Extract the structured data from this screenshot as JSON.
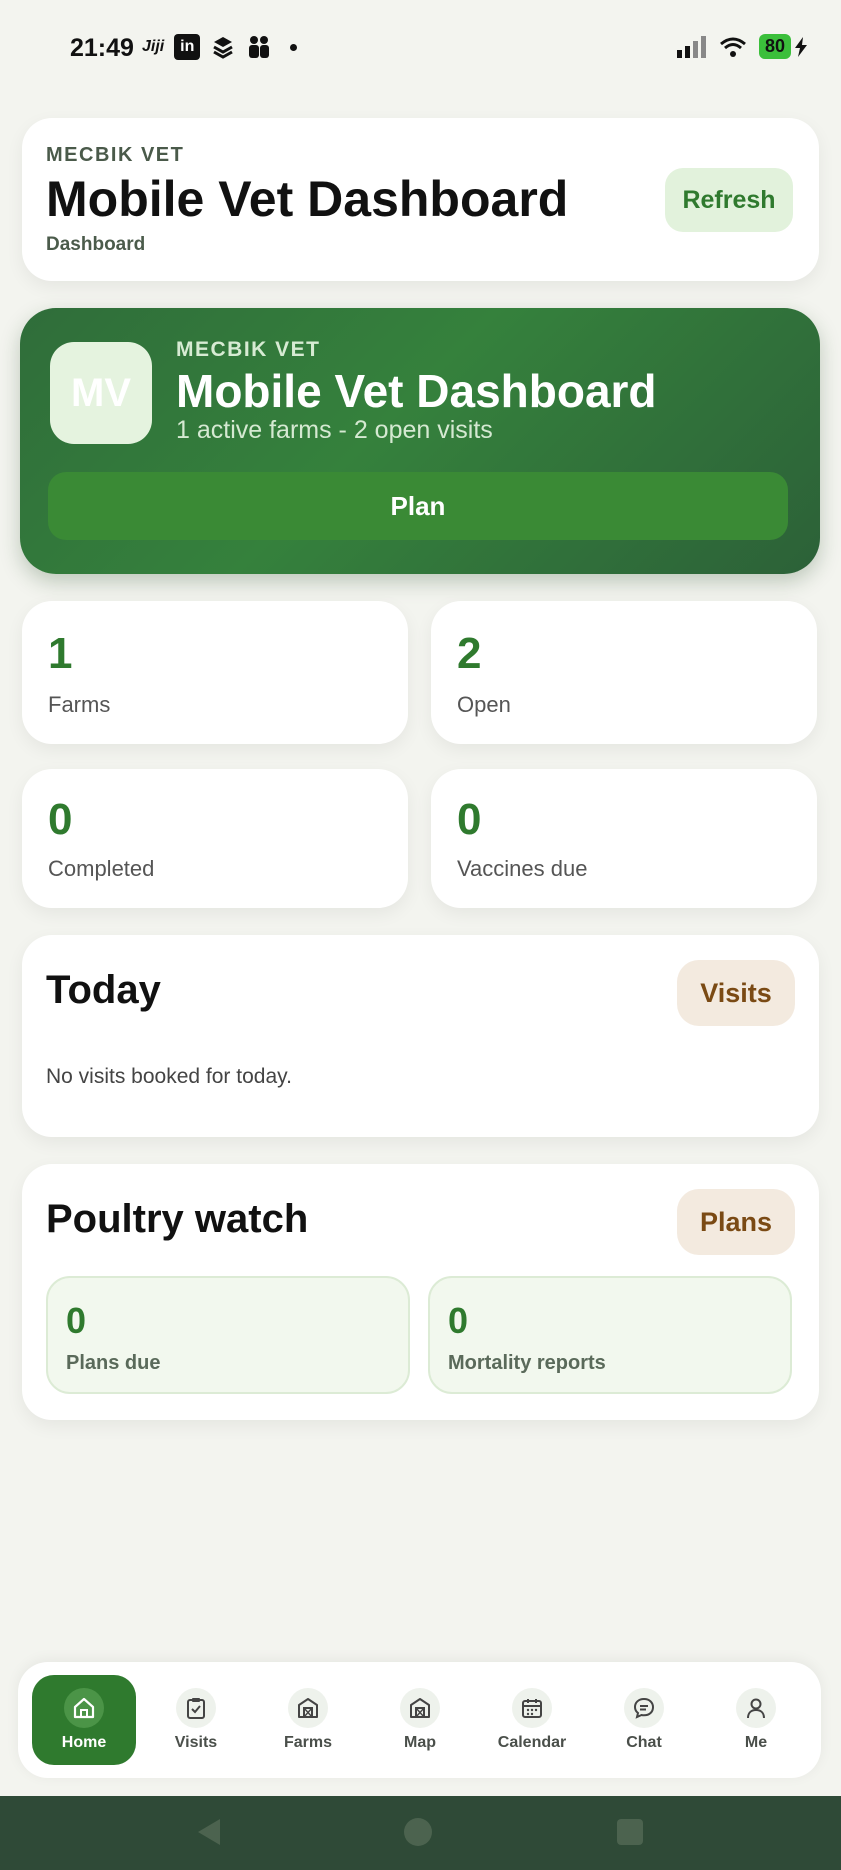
{
  "status_bar": {
    "time": "21:49",
    "app_label": "Jiji",
    "linkedin_label": "in",
    "battery": "80"
  },
  "header": {
    "eyebrow": "MECBIK VET",
    "title": "Mobile Vet Dashboard",
    "subtitle": "Dashboard",
    "refresh_label": "Refresh"
  },
  "hero": {
    "avatar_initials": "MV",
    "eyebrow": "MECBIK VET",
    "title": "Mobile Vet Dashboard",
    "subtitle": "1 active farms - 2 open visits",
    "plan_label": "Plan"
  },
  "stats": [
    {
      "value": "1",
      "label": "Farms"
    },
    {
      "value": "2",
      "label": "Open"
    },
    {
      "value": "0",
      "label": "Completed"
    },
    {
      "value": "0",
      "label": "Vaccines due"
    }
  ],
  "today": {
    "title": "Today",
    "button_label": "Visits",
    "empty_text": "No visits booked for today."
  },
  "poultry": {
    "title": "Poultry watch",
    "button_label": "Plans",
    "items": [
      {
        "value": "0",
        "label": "Plans due"
      },
      {
        "value": "0",
        "label": "Mortality reports"
      }
    ]
  },
  "nav": [
    {
      "label": "Home",
      "icon": "home-icon",
      "active": true
    },
    {
      "label": "Visits",
      "icon": "clipboard-check-icon"
    },
    {
      "label": "Farms",
      "icon": "barn-icon"
    },
    {
      "label": "Map",
      "icon": "barn-icon"
    },
    {
      "label": "Calendar",
      "icon": "calendar-icon"
    },
    {
      "label": "Chat",
      "icon": "chat-bubble-icon"
    },
    {
      "label": "Me",
      "icon": "user-icon"
    }
  ],
  "colors": {
    "accent": "#2f7a2e",
    "hero_start": "#2f6d3a",
    "pill_bg": "#f3eadf",
    "pill_text": "#7a4a14"
  }
}
